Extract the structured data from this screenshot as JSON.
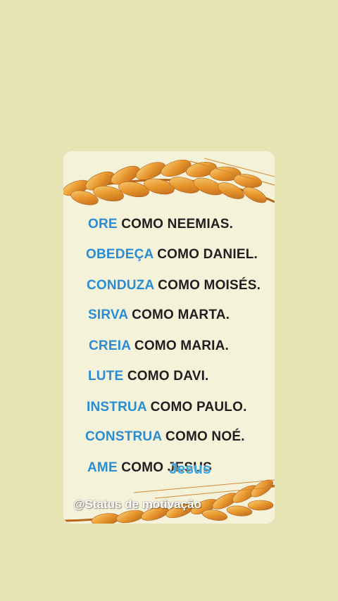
{
  "card": {
    "lines": [
      {
        "verb": "ORE",
        "rest": " COMO NEEMIAS."
      },
      {
        "verb": "OBEDEÇA",
        "rest": " COMO DANIEL."
      },
      {
        "verb": "CONDUZA",
        "rest": " COMO MOISÉS."
      },
      {
        "verb": "SIRVA",
        "rest": " COMO MARTA."
      },
      {
        "verb": "CREIA",
        "rest": " COMO MARIA."
      },
      {
        "verb": "LUTE",
        "rest": " COMO DAVI."
      },
      {
        "verb": "INSTRUA",
        "rest": " COMO PAULO."
      },
      {
        "verb": "CONSTRUA",
        "rest": " COMO NOÉ."
      },
      {
        "verb": "AME",
        "rest": " COMO JESUS"
      }
    ],
    "overlay_text": "Jesus",
    "watermark": "@Status de motivação"
  },
  "colors": {
    "background": "#e6e3b4",
    "card_background": "#f5f2da",
    "verb": "#2a8cd4",
    "text": "#1f1f1f",
    "overlay": "#35a7e0",
    "wheat": "#e8a23a"
  },
  "decorations": {
    "top_image": "wheat-ear-icon",
    "bottom_image": "wheat-ear-icon"
  }
}
